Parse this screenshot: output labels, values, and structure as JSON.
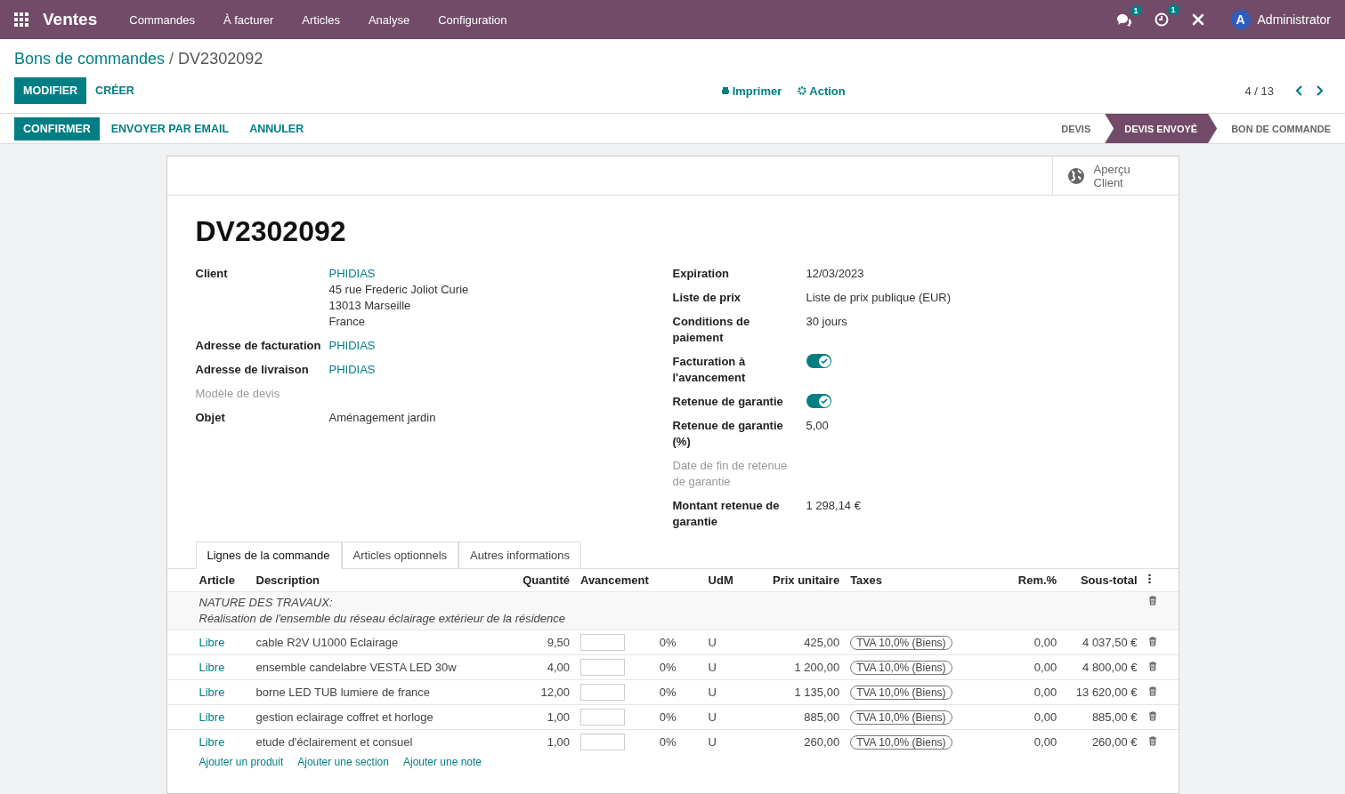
{
  "navbar": {
    "app": "Ventes",
    "menu": [
      "Commandes",
      "À facturer",
      "Articles",
      "Analyse",
      "Configuration"
    ],
    "messages_badge": "1",
    "activities_badge": "1",
    "avatar": "A",
    "user": "Administrator"
  },
  "breadcrumb": {
    "parent": "Bons de commandes",
    "separator": "/",
    "current": "DV2302092"
  },
  "buttons": {
    "edit": "MODIFIER",
    "create": "CRÉER",
    "print": "Imprimer",
    "action": "Action"
  },
  "pager": {
    "value": "4 / 13"
  },
  "actions": [
    {
      "label": "CONFIRMER",
      "primary": true
    },
    {
      "label": "ENVOYER PAR EMAIL",
      "primary": false
    },
    {
      "label": "ANNULER",
      "primary": false
    }
  ],
  "stages": [
    {
      "label": "DEVIS",
      "selected": false
    },
    {
      "label": "DEVIS ENVOYÉ",
      "selected": true
    },
    {
      "label": "BON DE COMMANDE",
      "selected": false
    }
  ],
  "smart_button": {
    "line1": "Aperçu",
    "line2": "Client"
  },
  "title": "DV2302092",
  "left_fields": [
    {
      "label": "Client",
      "kind": "link",
      "lines": [
        "PHIDIAS",
        "45 rue Frederic Joliot Curie",
        "13013 Marseille",
        "France"
      ],
      "muted": false
    },
    {
      "label": "Adresse de facturation",
      "kind": "link",
      "lines": [
        "PHIDIAS"
      ],
      "muted": false
    },
    {
      "label": "Adresse de livraison",
      "kind": "link",
      "lines": [
        "PHIDIAS"
      ],
      "muted": false
    },
    {
      "label": "Modèle de devis",
      "kind": "empty",
      "muted": true
    },
    {
      "label": "Objet",
      "kind": "text",
      "lines": [
        "Aménagement jardin"
      ],
      "muted": false
    }
  ],
  "right_fields": [
    {
      "label": "Expiration",
      "kind": "text",
      "value": "12/03/2023",
      "muted": false
    },
    {
      "label": "Liste de prix",
      "kind": "text",
      "value": "Liste de prix publique (EUR)",
      "muted": false
    },
    {
      "label": "Conditions de paiement",
      "kind": "text",
      "value": "30 jours",
      "muted": false
    },
    {
      "label": "Facturation à l'avancement",
      "kind": "toggle",
      "on": true,
      "muted": false
    },
    {
      "label": "Retenue de garantie",
      "kind": "toggle",
      "on": true,
      "muted": false
    },
    {
      "label": "Retenue de garantie (%)",
      "kind": "text",
      "value": "5,00",
      "muted": false
    },
    {
      "label": "Date de fin de retenue de garantie",
      "kind": "empty",
      "muted": true
    },
    {
      "label": "Montant retenue de garantie",
      "kind": "text",
      "value": "1 298,14 €",
      "muted": false
    }
  ],
  "tabs": [
    {
      "label": "Lignes de la commande",
      "selected": true
    },
    {
      "label": "Articles optionnels",
      "selected": false
    },
    {
      "label": "Autres informations",
      "selected": false
    }
  ],
  "table": {
    "columns": [
      "Article",
      "Description",
      "Quantité",
      "Avancement",
      "UdM",
      "Prix unitaire",
      "Taxes",
      "Rem.%",
      "Sous-total"
    ],
    "note": {
      "line1": "NATURE DES TRAVAUX:",
      "line2": "Réalisation de l'ensemble du réseau éclairage extérieur de la résidence"
    },
    "rows": [
      {
        "article": "Libre",
        "description": "cable R2V U1000 Eclairage",
        "qty": "9,50",
        "progress": "0%",
        "uom": "U",
        "price": "425,00",
        "tax": "TVA 10,0% (Biens)",
        "discount": "0,00",
        "subtotal": "4 037,50 €"
      },
      {
        "article": "Libre",
        "description": "ensemble candelabre VESTA LED 30w",
        "qty": "4,00",
        "progress": "0%",
        "uom": "U",
        "price": "1 200,00",
        "tax": "TVA 10,0% (Biens)",
        "discount": "0,00",
        "subtotal": "4 800,00 €"
      },
      {
        "article": "Libre",
        "description": "borne LED TUB lumiere de france",
        "qty": "12,00",
        "progress": "0%",
        "uom": "U",
        "price": "1 135,00",
        "tax": "TVA 10,0% (Biens)",
        "discount": "0,00",
        "subtotal": "13 620,00 €"
      },
      {
        "article": "Libre",
        "description": "gestion eclairage coffret et horloge",
        "qty": "1,00",
        "progress": "0%",
        "uom": "U",
        "price": "885,00",
        "tax": "TVA 10,0% (Biens)",
        "discount": "0,00",
        "subtotal": "885,00 €"
      },
      {
        "article": "Libre",
        "description": "etude d'éclairement et consuel",
        "qty": "1,00",
        "progress": "0%",
        "uom": "U",
        "price": "260,00",
        "tax": "TVA 10,0% (Biens)",
        "discount": "0,00",
        "subtotal": "260,00 €"
      }
    ],
    "add_links": [
      "Ajouter un produit",
      "Ajouter une section",
      "Ajouter une note"
    ]
  }
}
